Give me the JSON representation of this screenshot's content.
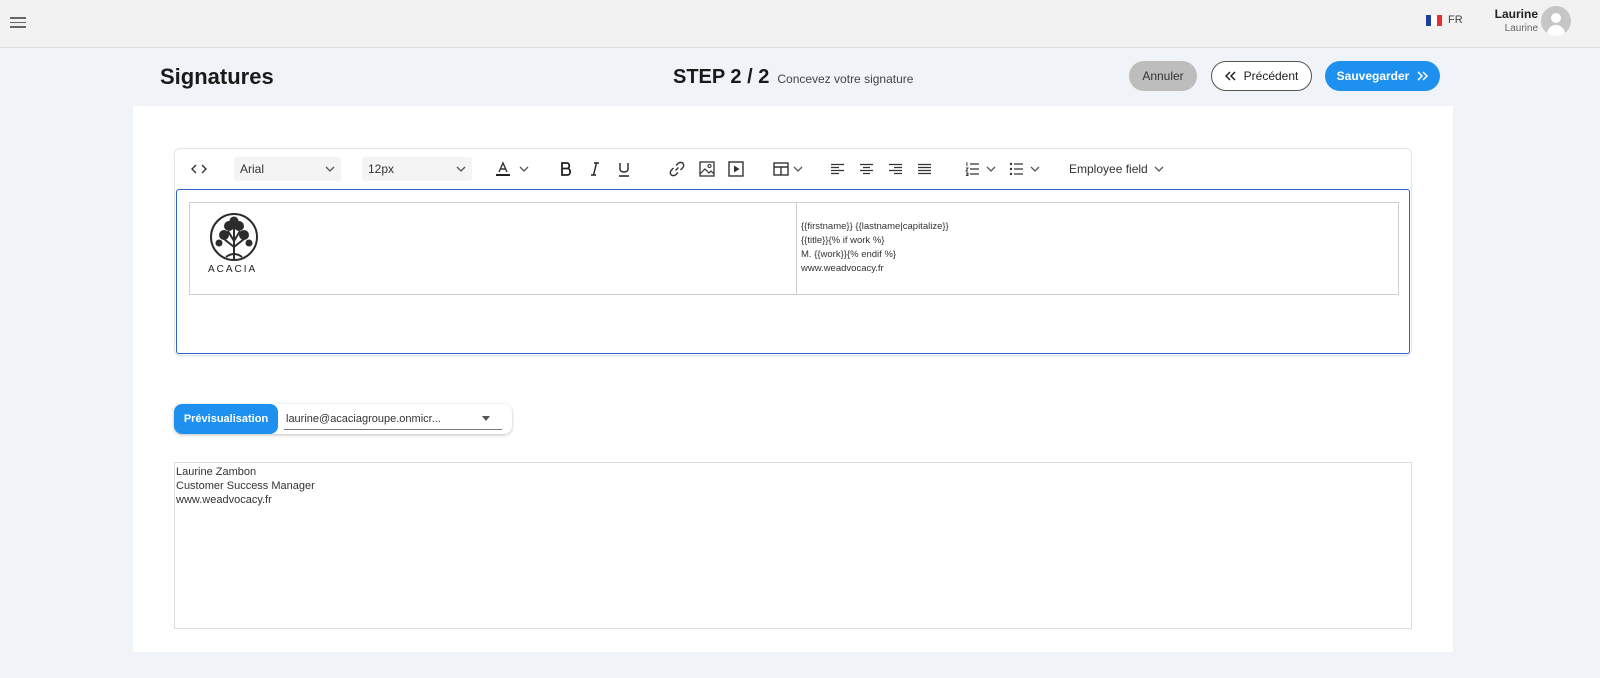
{
  "header": {
    "language": "FR",
    "user_name": "Laurine",
    "user_sub": "Laurine"
  },
  "page": {
    "title": "Signatures",
    "step": "STEP 2 / 2",
    "step_subtitle": "Concevez votre signature"
  },
  "actions": {
    "cancel": "Annuler",
    "previous": "Précédent",
    "save": "Sauvegarder"
  },
  "toolbar": {
    "font": "Arial",
    "size": "12px",
    "employee_field": "Employee field"
  },
  "signature": {
    "logo_text": "ACACIA",
    "template_lines": [
      "{{firstname}} {{lastname|capitalize}}",
      "{{title}}{% if work %}",
      "M. {{work}}{% endif %}",
      "www.weadvocacy.fr"
    ]
  },
  "preview": {
    "button": "Prévisualisation",
    "selected_email": "laurine@acaciagroupe.onmicr...",
    "lines": [
      "Laurine Zambon",
      "Customer Success Manager",
      "www.weadvocacy.fr"
    ]
  },
  "colors": {
    "accent": "#1e90f0",
    "editor_border": "#2f5fc8",
    "cancel_bg": "#bdbdbd"
  }
}
